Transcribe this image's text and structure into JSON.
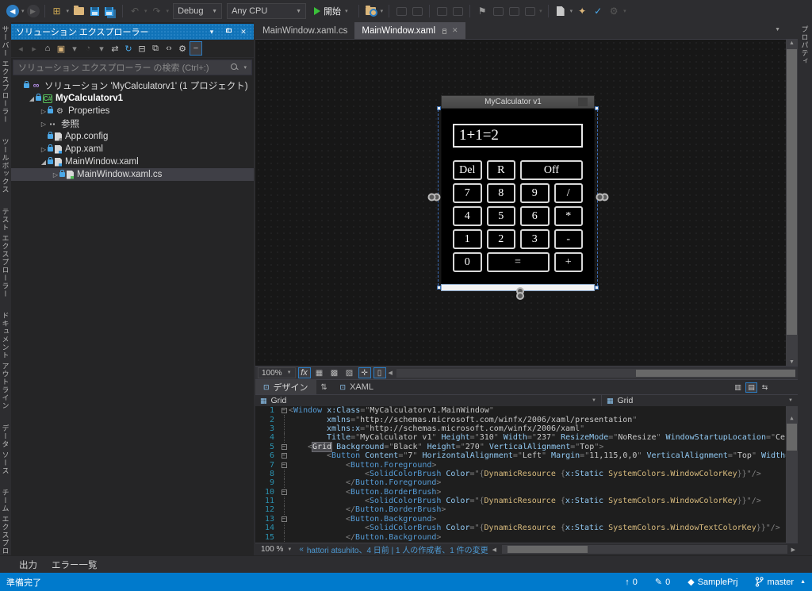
{
  "colors": {
    "accent": "#007acc",
    "titlebar_blue": "#1173b8",
    "selection_grey": "#3f3f46"
  },
  "toolbar": {
    "debug_label": "Debug",
    "platform_label": "Any CPU",
    "start_label": "開始",
    "items": [
      {
        "kind": "icon",
        "name": "nav-back-icon",
        "glyph": "◀",
        "style": "circle-blue"
      },
      {
        "kind": "caret",
        "name": "nav-back-caret"
      },
      {
        "kind": "icon",
        "name": "nav-forward-icon",
        "glyph": "▶",
        "style": "circle-dim"
      },
      {
        "kind": "sep"
      },
      {
        "kind": "icon",
        "name": "new-project-icon",
        "glyph": "⊞",
        "color": "#c8a452"
      },
      {
        "kind": "caret",
        "name": "new-project-caret"
      },
      {
        "kind": "shape",
        "name": "open-folder-icon",
        "cls": "i-folder"
      },
      {
        "kind": "shape",
        "name": "save-icon",
        "cls": "i-floppy"
      },
      {
        "kind": "shape",
        "name": "save-all-icon",
        "cls": "i-floppy i-floppy2"
      },
      {
        "kind": "sep"
      },
      {
        "kind": "icon",
        "name": "undo-icon",
        "glyph": "↶",
        "dim": true
      },
      {
        "kind": "caret",
        "name": "undo-caret",
        "dim": true
      },
      {
        "kind": "icon",
        "name": "redo-icon",
        "glyph": "↷",
        "dim": true
      },
      {
        "kind": "caret",
        "name": "redo-caret",
        "dim": true
      },
      {
        "kind": "dropdown",
        "name": "debug-config-dropdown",
        "bind": "debug_label",
        "width": 62
      },
      {
        "kind": "dropdown",
        "name": "platform-dropdown",
        "bind": "platform_label",
        "width": 100
      },
      {
        "kind": "run",
        "name": "start-debugging-button"
      },
      {
        "kind": "sep"
      },
      {
        "kind": "shape",
        "name": "find-in-files-icon",
        "cls": "i-folder find"
      },
      {
        "kind": "caret",
        "name": "find-caret"
      },
      {
        "kind": "sep"
      },
      {
        "kind": "shape",
        "name": "comment-icon",
        "cls": "i-ph"
      },
      {
        "kind": "shape",
        "name": "uncomment-icon",
        "cls": "i-ph"
      },
      {
        "kind": "sep"
      },
      {
        "kind": "shape",
        "name": "indent-decrease-icon",
        "cls": "i-ph"
      },
      {
        "kind": "shape",
        "name": "indent-increase-icon",
        "cls": "i-ph"
      },
      {
        "kind": "sep"
      },
      {
        "kind": "icon",
        "name": "toggle-bookmark-icon",
        "glyph": "⚑",
        "color": "#9a9a9a"
      },
      {
        "kind": "shape",
        "name": "prev-bookmark-icon",
        "cls": "i-ph"
      },
      {
        "kind": "shape",
        "name": "next-bookmark-icon",
        "cls": "i-ph"
      },
      {
        "kind": "shape",
        "name": "clear-bookmarks-icon",
        "cls": "i-ph"
      },
      {
        "kind": "caret",
        "name": "bookmark-caret",
        "dim": true
      },
      {
        "kind": "sep"
      },
      {
        "kind": "shape",
        "name": "document-outline-icon",
        "cls": "i-doc"
      },
      {
        "kind": "caret",
        "name": "document-caret"
      },
      {
        "kind": "icon",
        "name": "new-item-icon",
        "glyph": "✦",
        "color": "#dcb67a"
      },
      {
        "kind": "icon",
        "name": "add-check-icon",
        "glyph": "✓",
        "color": "#4ba8e8"
      },
      {
        "kind": "icon",
        "name": "attach-icon",
        "glyph": "⚙",
        "dim": true
      },
      {
        "kind": "caret",
        "name": "attach-caret",
        "dim": true
      }
    ]
  },
  "left_tabs": [
    {
      "label": "サーバー エクスプローラー"
    },
    {
      "label": "ツールボックス"
    },
    {
      "label": "テスト エクスプローラー"
    },
    {
      "label": "ドキュメント アウトライン"
    },
    {
      "label": "データ ソース"
    },
    {
      "label": "チーム エクスプローラー"
    }
  ],
  "right_tabs": [
    {
      "label": "プロパティ"
    }
  ],
  "solution_explorer": {
    "title": "ソリューション エクスプローラー",
    "search_placeholder": "ソリューション エクスプローラー の検索 (Ctrl+:)",
    "toolbar_icons": [
      {
        "name": "se-back-icon",
        "glyph": "◂",
        "dim": true
      },
      {
        "name": "se-forward-icon",
        "glyph": "▸",
        "dim": true
      },
      {
        "name": "se-home-icon",
        "glyph": "⌂"
      },
      {
        "name": "se-switch-views-icon",
        "glyph": "▣",
        "color": "#dcb67a"
      },
      {
        "name": "se-switch-caret",
        "glyph": "▾",
        "caret": true
      },
      {
        "name": "se-pending-changes-icon",
        "glyph": "◔",
        "dim": true
      },
      {
        "name": "se-pending-caret",
        "glyph": "▾",
        "caret": true
      },
      {
        "name": "se-sync-icon",
        "glyph": "⇄"
      },
      {
        "name": "se-refresh-icon",
        "glyph": "↻",
        "color": "#4ba8e8"
      },
      {
        "name": "se-collapse-all-icon",
        "glyph": "⊟"
      },
      {
        "name": "se-show-all-files-icon",
        "glyph": "⧉"
      },
      {
        "name": "se-view-code-icon",
        "glyph": "‹›"
      },
      {
        "name": "se-properties-icon",
        "glyph": "⚙"
      },
      {
        "name": "se-preview-selected-icon",
        "glyph": "−",
        "boxed": true
      }
    ],
    "tree": [
      {
        "label": "ソリューション 'MyCalculatorv1' (1 プロジェクト)",
        "icon": "solution",
        "glyph": "∞",
        "indent": 0,
        "expander": "",
        "lock": true
      },
      {
        "label": "MyCalculatorv1",
        "icon": "csproj",
        "glyph": "C#",
        "indent": 1,
        "expander": "open",
        "lock": true,
        "bold": true
      },
      {
        "label": "Properties",
        "icon": "wrench",
        "glyph": "⚙",
        "indent": 2,
        "expander": "closed",
        "lock": true
      },
      {
        "label": "参照",
        "icon": "refs",
        "glyph": "▪▪",
        "indent": 2,
        "expander": "closed",
        "lock": false
      },
      {
        "label": "App.config",
        "icon": "cfg",
        "glyph": "",
        "indent": 2,
        "expander": "",
        "lock": true
      },
      {
        "label": "App.xaml",
        "icon": "xaml",
        "glyph": "",
        "indent": 2,
        "expander": "closed",
        "lock": true
      },
      {
        "label": "MainWindow.xaml",
        "icon": "xaml",
        "glyph": "",
        "indent": 2,
        "expander": "open",
        "lock": true
      },
      {
        "label": "MainWindow.xaml.cs",
        "icon": "cs",
        "glyph": "",
        "indent": 3,
        "expander": "closed",
        "lock": true,
        "selected": true
      }
    ]
  },
  "editor": {
    "tabs": [
      {
        "label": "MainWindow.xaml.cs",
        "active": false
      },
      {
        "label": "MainWindow.xaml",
        "active": true
      }
    ],
    "designer": {
      "zoom": "100%",
      "toolbar_icons": [
        {
          "name": "effects-button",
          "glyph": "fx",
          "boxed": true,
          "fx": true
        },
        {
          "name": "show-grid-button",
          "glyph": "▦"
        },
        {
          "name": "snap-to-grid-button",
          "glyph": "▩"
        },
        {
          "name": "show-snapgrid-button",
          "glyph": "▨"
        },
        {
          "name": "snaplines-button",
          "glyph": "✛",
          "boxed": true
        },
        {
          "name": "zoom-to-fit-button",
          "glyph": "▯",
          "boxed": true
        }
      ],
      "calculator": {
        "window_title": "MyCalculator v1",
        "display_value": "1+1=2",
        "button_rows": [
          [
            {
              "label": "Del"
            },
            {
              "label": "R"
            },
            {
              "label": "Off",
              "span": 2
            }
          ],
          [
            {
              "label": "7"
            },
            {
              "label": "8"
            },
            {
              "label": "9"
            },
            {
              "label": "/"
            }
          ],
          [
            {
              "label": "4"
            },
            {
              "label": "5"
            },
            {
              "label": "6"
            },
            {
              "label": "*"
            }
          ],
          [
            {
              "label": "1"
            },
            {
              "label": "2"
            },
            {
              "label": "3"
            },
            {
              "label": "-"
            }
          ],
          [
            {
              "label": "0"
            },
            {
              "label": "=",
              "span": 2
            },
            {
              "label": "+"
            }
          ]
        ]
      }
    },
    "split": {
      "design_label": "デザイン",
      "xaml_label": "XAML",
      "swap_glyph": "⇅",
      "design_icon_glyph": "⊡",
      "xaml_icon_glyph": "⊡",
      "right_icons": [
        {
          "name": "split-vertical-button",
          "glyph": "▥"
        },
        {
          "name": "split-horizontal-button",
          "glyph": "▤",
          "active": true
        },
        {
          "name": "swap-panes-button",
          "glyph": "⇆"
        }
      ]
    },
    "breadcrumbs": {
      "left": "Grid",
      "right": "Grid"
    },
    "code_lines": [
      {
        "n": "1",
        "ind": 0,
        "fold": true,
        "tokens": [
          [
            "d",
            "<"
          ],
          [
            "e",
            "Window "
          ],
          [
            "a",
            "x:Class"
          ],
          [
            "d",
            "=\""
          ],
          [
            "v",
            "MyCalculatorv1.MainWindow"
          ],
          [
            "d",
            "\""
          ]
        ]
      },
      {
        "n": "2",
        "ind": 8,
        "fold": false,
        "tokens": [
          [
            "a",
            "xmlns"
          ],
          [
            "d",
            "=\""
          ],
          [
            "v",
            "http://schemas.microsoft.com/winfx/2006/xaml/presentation"
          ],
          [
            "d",
            "\""
          ]
        ]
      },
      {
        "n": "3",
        "ind": 8,
        "fold": false,
        "tokens": [
          [
            "a",
            "xmlns:x"
          ],
          [
            "d",
            "=\""
          ],
          [
            "v",
            "http://schemas.microsoft.com/winfx/2006/xaml"
          ],
          [
            "d",
            "\""
          ]
        ]
      },
      {
        "n": "4",
        "ind": 8,
        "fold": false,
        "tokens": [
          [
            "a",
            "Title"
          ],
          [
            "d",
            "=\""
          ],
          [
            "v",
            "MyCalculator v1"
          ],
          [
            "d",
            "\" "
          ],
          [
            "a",
            "Height"
          ],
          [
            "d",
            "=\""
          ],
          [
            "v",
            "310"
          ],
          [
            "d",
            "\" "
          ],
          [
            "a",
            "Width"
          ],
          [
            "d",
            "=\""
          ],
          [
            "v",
            "237"
          ],
          [
            "d",
            "\" "
          ],
          [
            "a",
            "ResizeMode"
          ],
          [
            "d",
            "=\""
          ],
          [
            "v",
            "NoResize"
          ],
          [
            "d",
            "\" "
          ],
          [
            "a",
            "WindowStartupLocation"
          ],
          [
            "d",
            "=\""
          ],
          [
            "v",
            "Cen"
          ]
        ]
      },
      {
        "n": "5",
        "ind": 4,
        "fold": true,
        "tokens": [
          [
            "d",
            "<"
          ],
          [
            "h",
            "Grid"
          ],
          [
            "d",
            " "
          ],
          [
            "a",
            "Background"
          ],
          [
            "d",
            "=\""
          ],
          [
            "v",
            "Black"
          ],
          [
            "d",
            "\" "
          ],
          [
            "a",
            "Height"
          ],
          [
            "d",
            "=\""
          ],
          [
            "v",
            "270"
          ],
          [
            "d",
            "\" "
          ],
          [
            "a",
            "VerticalAlignment"
          ],
          [
            "d",
            "=\""
          ],
          [
            "v",
            "Top"
          ],
          [
            "d",
            "\">"
          ]
        ]
      },
      {
        "n": "6",
        "ind": 8,
        "fold": true,
        "tokens": [
          [
            "d",
            "<"
          ],
          [
            "e",
            "Button "
          ],
          [
            "a",
            "Content"
          ],
          [
            "d",
            "=\""
          ],
          [
            "v",
            "7"
          ],
          [
            "d",
            "\" "
          ],
          [
            "a",
            "HorizontalAlignment"
          ],
          [
            "d",
            "=\""
          ],
          [
            "v",
            "Left"
          ],
          [
            "d",
            "\" "
          ],
          [
            "a",
            "Margin"
          ],
          [
            "d",
            "=\""
          ],
          [
            "v",
            "11,115,0,0"
          ],
          [
            "d",
            "\" "
          ],
          [
            "a",
            "VerticalAlignment"
          ],
          [
            "d",
            "=\""
          ],
          [
            "v",
            "Top"
          ],
          [
            "d",
            "\" "
          ],
          [
            "a",
            "Width"
          ],
          [
            "d",
            "="
          ]
        ]
      },
      {
        "n": "7",
        "ind": 12,
        "fold": true,
        "tokens": [
          [
            "d",
            "<"
          ],
          [
            "e",
            "Button.Foreground"
          ],
          [
            "d",
            ">"
          ]
        ]
      },
      {
        "n": "8",
        "ind": 16,
        "fold": false,
        "tokens": [
          [
            "d",
            "<"
          ],
          [
            "e",
            "SolidColorBrush "
          ],
          [
            "a",
            "Color"
          ],
          [
            "d",
            "=\"{"
          ],
          [
            "m",
            "DynamicResource"
          ],
          [
            "d",
            " {"
          ],
          [
            "a",
            "x:Static"
          ],
          [
            "m",
            " SystemColors.WindowColorKey"
          ],
          [
            "d",
            "}}\"/>"
          ]
        ]
      },
      {
        "n": "9",
        "ind": 12,
        "fold": false,
        "tokens": [
          [
            "d",
            "</"
          ],
          [
            "e",
            "Button.Foreground"
          ],
          [
            "d",
            ">"
          ]
        ]
      },
      {
        "n": "10",
        "ind": 12,
        "fold": true,
        "tokens": [
          [
            "d",
            "<"
          ],
          [
            "e",
            "Button.BorderBrush"
          ],
          [
            "d",
            ">"
          ]
        ]
      },
      {
        "n": "11",
        "ind": 16,
        "fold": false,
        "tokens": [
          [
            "d",
            "<"
          ],
          [
            "e",
            "SolidColorBrush "
          ],
          [
            "a",
            "Color"
          ],
          [
            "d",
            "=\"{"
          ],
          [
            "m",
            "DynamicResource"
          ],
          [
            "d",
            " {"
          ],
          [
            "a",
            "x:Static"
          ],
          [
            "m",
            " SystemColors.WindowColorKey"
          ],
          [
            "d",
            "}}\"/>"
          ]
        ]
      },
      {
        "n": "12",
        "ind": 12,
        "fold": false,
        "tokens": [
          [
            "d",
            "</"
          ],
          [
            "e",
            "Button.BorderBrush"
          ],
          [
            "d",
            ">"
          ]
        ]
      },
      {
        "n": "13",
        "ind": 12,
        "fold": true,
        "tokens": [
          [
            "d",
            "<"
          ],
          [
            "e",
            "Button.Background"
          ],
          [
            "d",
            ">"
          ]
        ]
      },
      {
        "n": "14",
        "ind": 16,
        "fold": false,
        "tokens": [
          [
            "d",
            "<"
          ],
          [
            "e",
            "SolidColorBrush "
          ],
          [
            "a",
            "Color"
          ],
          [
            "d",
            "=\"{"
          ],
          [
            "m",
            "DynamicResource"
          ],
          [
            "d",
            " {"
          ],
          [
            "a",
            "x:Static"
          ],
          [
            "m",
            " SystemColors.WindowTextColorKey"
          ],
          [
            "d",
            "}}\"/>"
          ]
        ]
      },
      {
        "n": "15",
        "ind": 12,
        "fold": false,
        "tokens": [
          [
            "d",
            "</"
          ],
          [
            "e",
            "Button.Background"
          ],
          [
            "d",
            ">"
          ]
        ]
      }
    ],
    "bottom": {
      "zoom": "100 %",
      "codelens_glyph": "«",
      "git_info": "hattori atsuhito、4 日前 | 1 人の作成者、1 件の変更"
    }
  },
  "bottom_panel": {
    "tabs": [
      {
        "label": "出力"
      },
      {
        "label": "エラー一覧"
      }
    ]
  },
  "status_bar": {
    "ready_text": "準備完了",
    "push_count": "0",
    "edit_count": "0",
    "repo_name": "SamplePrj",
    "branch_name": "master"
  }
}
